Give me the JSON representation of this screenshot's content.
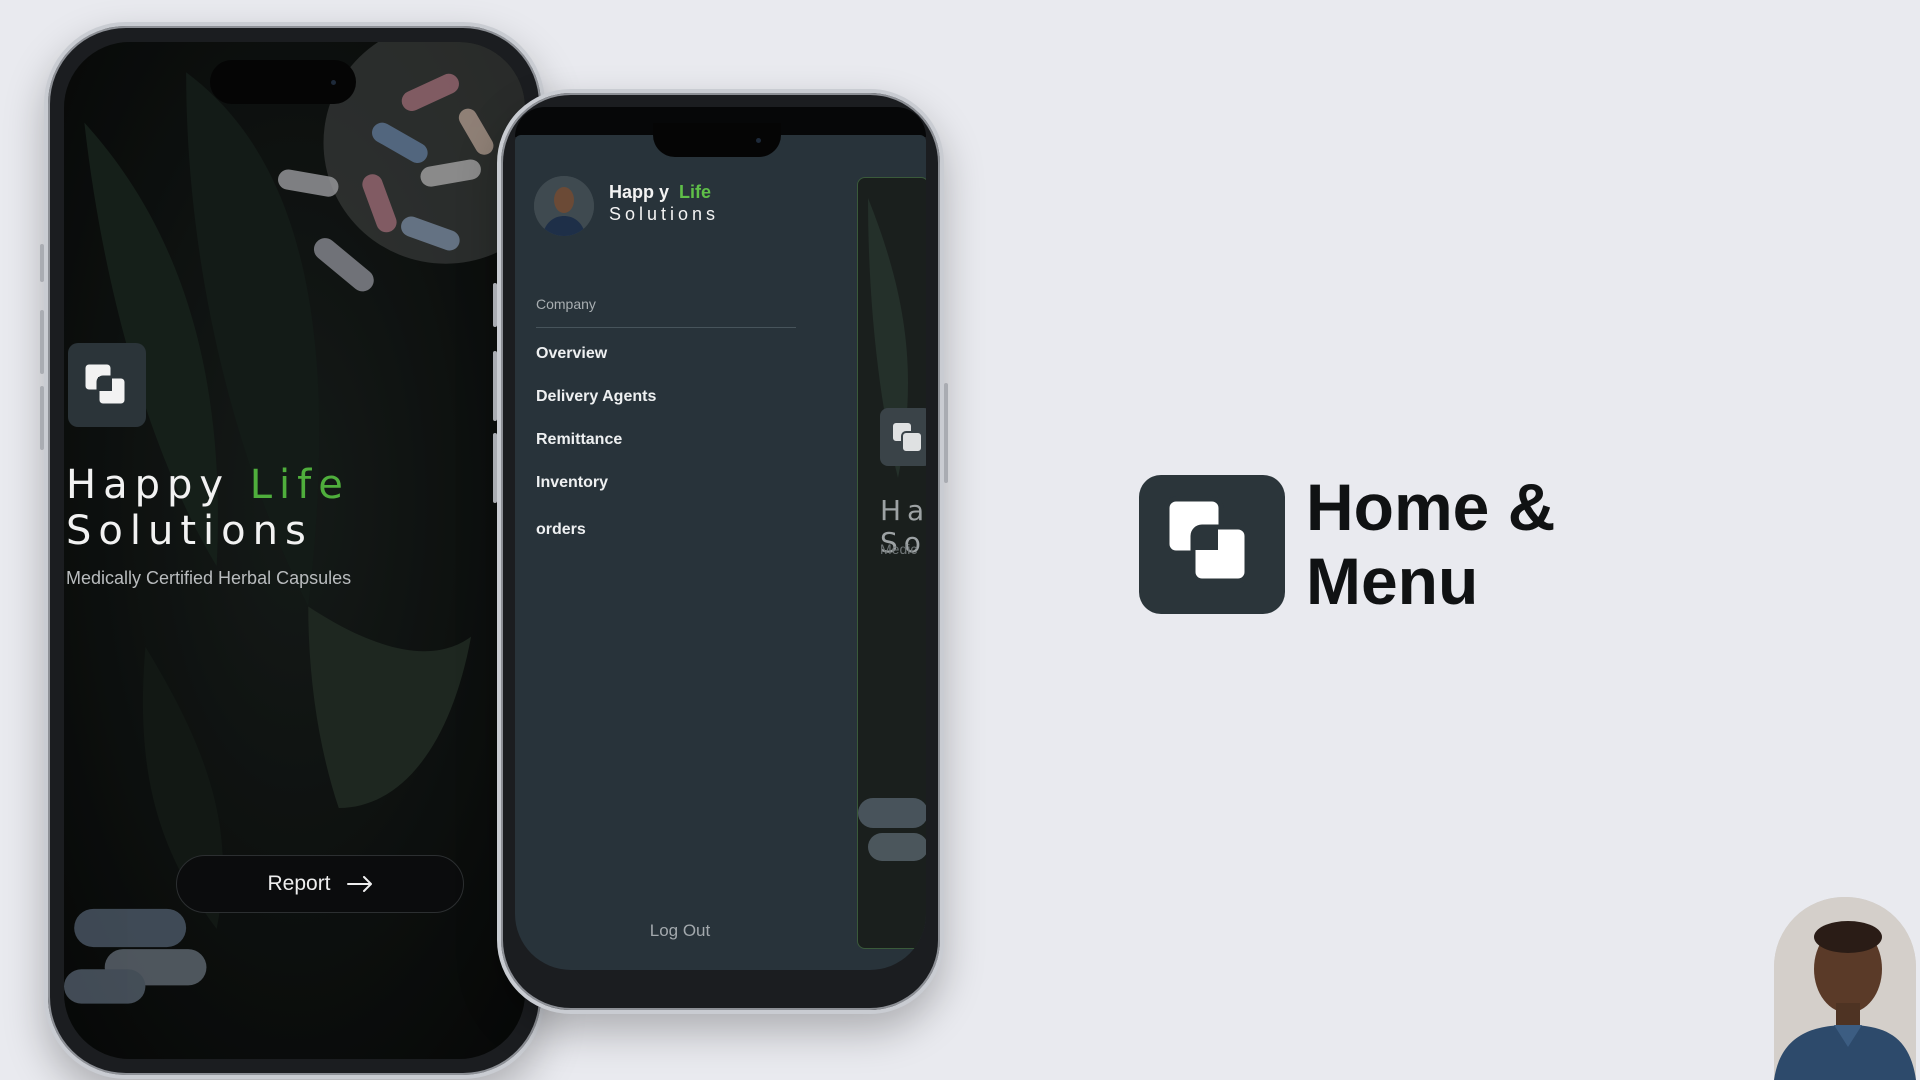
{
  "slide": {
    "title_line1": "Home &",
    "title_line2": "Menu",
    "colors": {
      "background": "#e9eaef",
      "accent_green": "#4fae3c",
      "tile": "#2b353a"
    },
    "logo_icon": "overlapping-squares-icon"
  },
  "home_screen": {
    "brand_word1": "Happy",
    "brand_word2": "Life",
    "brand_line2": "Solutions",
    "subtitle": "Medically Certified Herbal Capsules",
    "report_button": {
      "label": "Report",
      "icon": "arrow-right-icon"
    },
    "background": "herbal leaves and capsules photo"
  },
  "menu_screen": {
    "brand_word1": "Happ y",
    "brand_word2": "Life",
    "brand_line2": "Solutions",
    "section_label": "Company",
    "items": [
      {
        "label": "Overview"
      },
      {
        "label": "Delivery Agents"
      },
      {
        "label": "Remittance"
      },
      {
        "label": "Inventory"
      },
      {
        "label": "orders"
      }
    ],
    "logout_label": "Log Out",
    "peek_text_line1": "Ha",
    "peek_text_line2": "So",
    "peek_sub": "Medic"
  },
  "presenter": {
    "icon": "presenter-photo"
  }
}
